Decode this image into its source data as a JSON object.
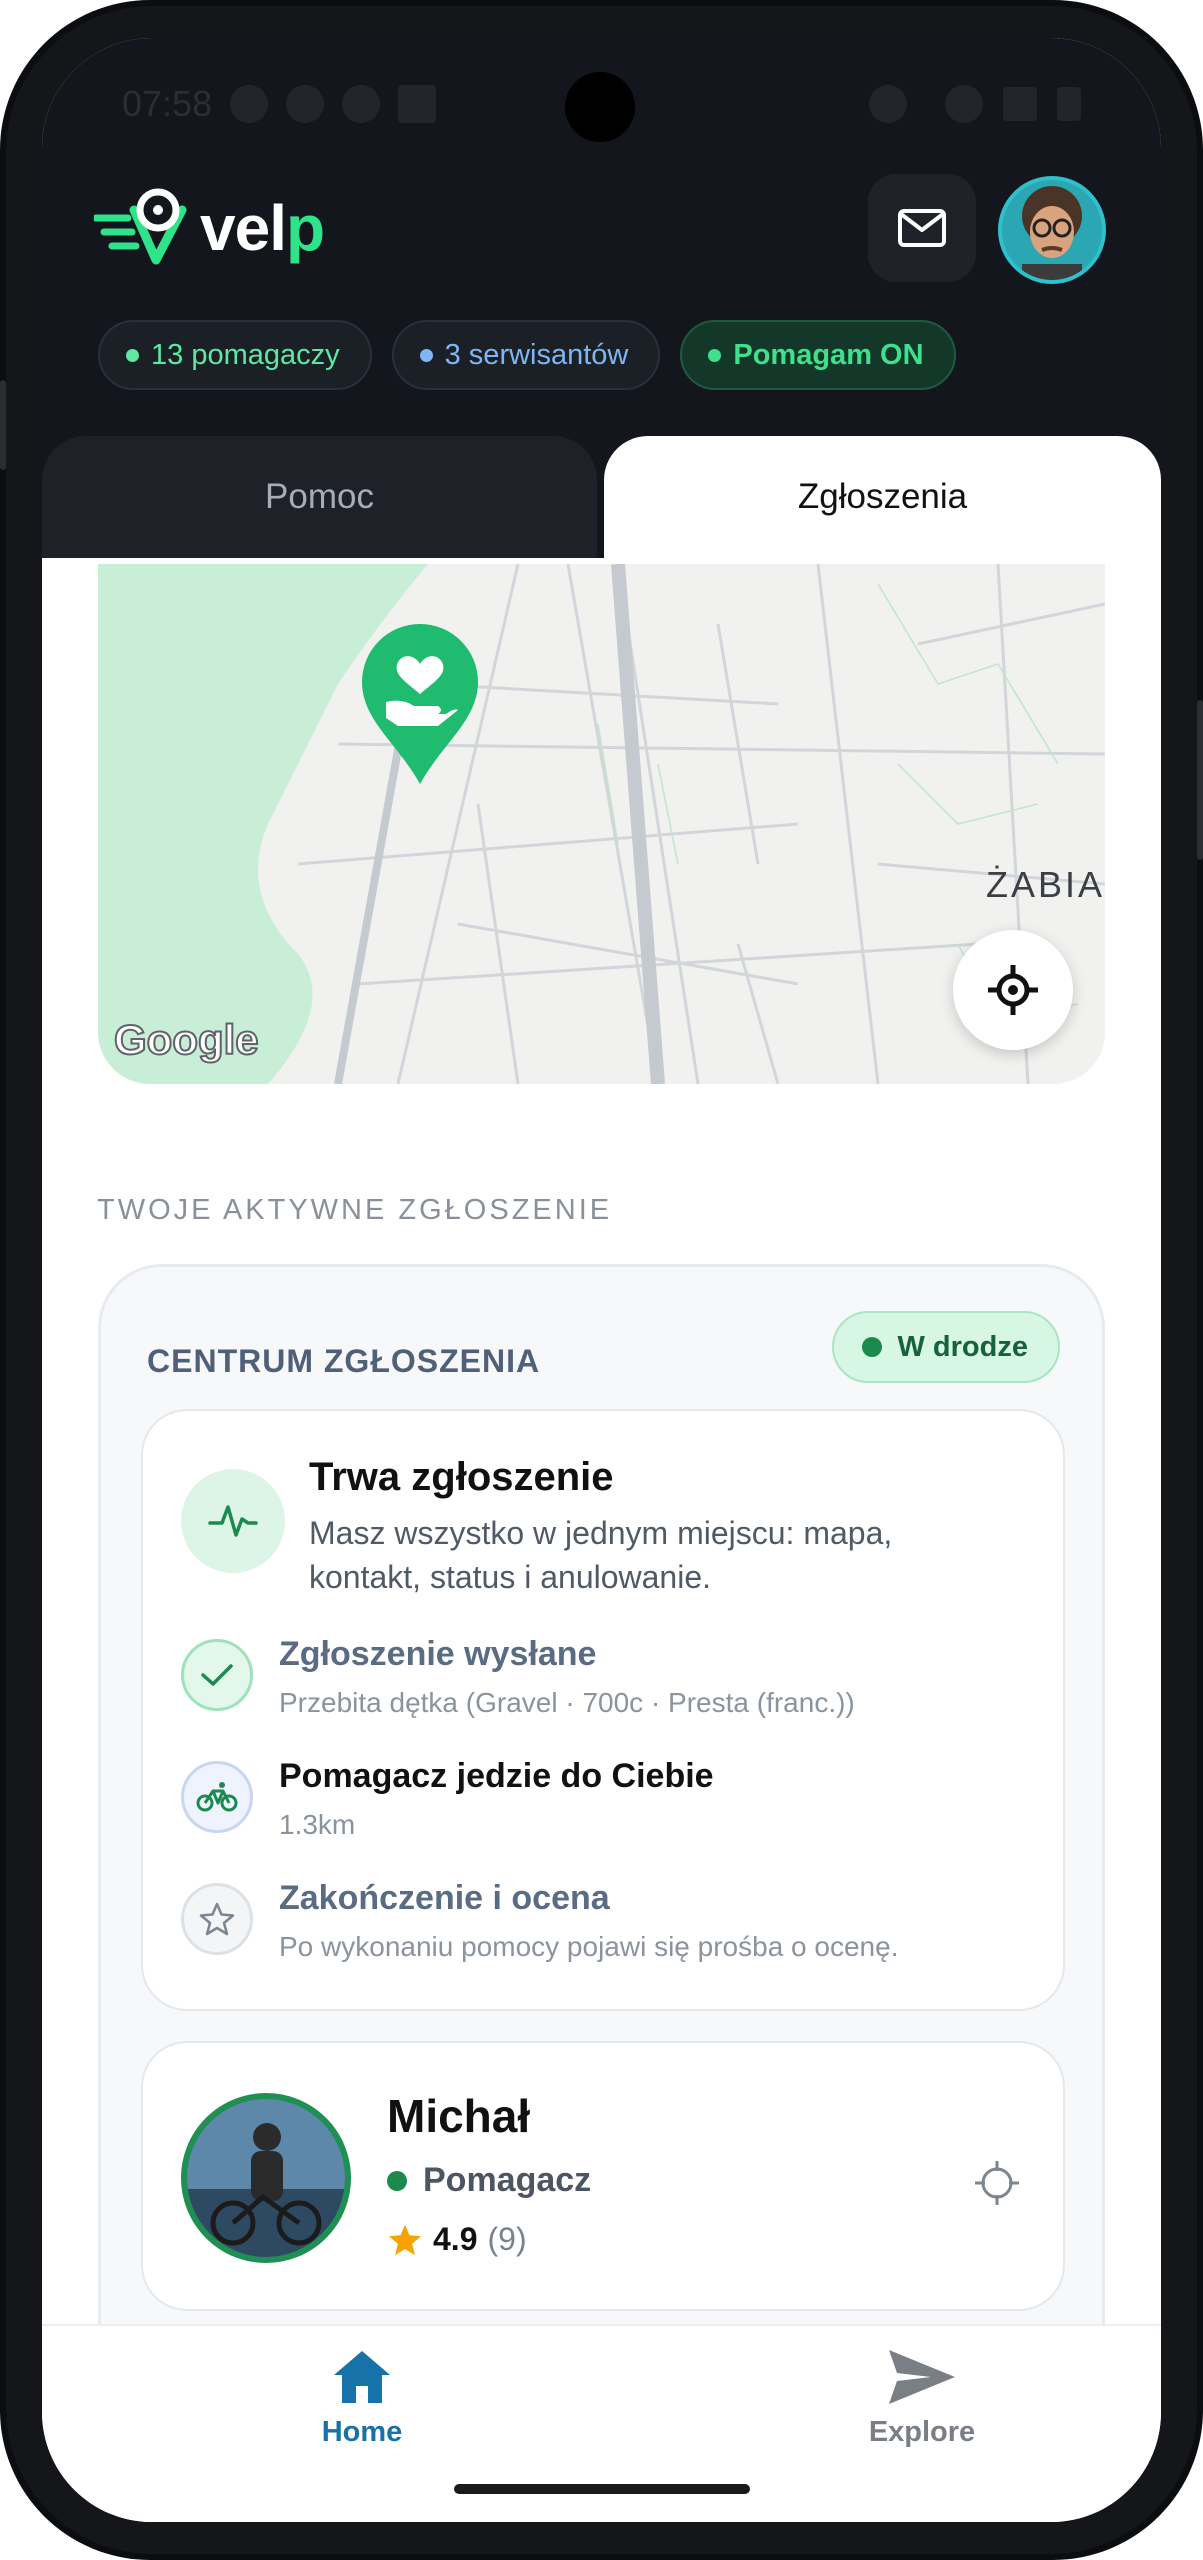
{
  "status_bar": {
    "time": "07:58"
  },
  "header": {
    "logo_text": "vel",
    "logo_text_accent": "p",
    "chips": [
      {
        "label": "13 pomagaczy",
        "color": "#5fe8a2"
      },
      {
        "label": "3 serwisantów",
        "color": "#7fb5f2"
      },
      {
        "label": "Pomagam ON",
        "color": "#3ee08b"
      }
    ]
  },
  "tabs": [
    {
      "label": "Pomoc",
      "active": false
    },
    {
      "label": "Zgłoszenia",
      "active": true
    }
  ],
  "map": {
    "district_label": "ŻABIA",
    "attribution": "Google",
    "marker_icon": "heart-hand-icon"
  },
  "active_section_label": "TWOJE AKTYWNE ZGŁOSZENIE",
  "request_center": {
    "title": "CENTRUM ZGŁOSZENIA",
    "status_badge": "W drodze",
    "summary_title": "Trwa zgłoszenie",
    "summary_text": "Masz wszystko w jednym miejscu: mapa, kontakt, status i anulowanie.",
    "steps": [
      {
        "title": "Zgłoszenie wysłane",
        "subtitle": "Przebita dętka (Gravel · 700c · Presta (franc.))",
        "state": "done"
      },
      {
        "title": "Pomagacz jedzie do Ciebie",
        "subtitle": "1.3km",
        "state": "active"
      },
      {
        "title": "Zakończenie i ocena",
        "subtitle": "Po wykonaniu pomocy pojawi się prośba o ocenę.",
        "state": "pending"
      }
    ]
  },
  "helper": {
    "name": "Michał",
    "role": "Pomagacz",
    "rating": "4.9",
    "rating_count": "(9)"
  },
  "bottom_nav": [
    {
      "label": "Home",
      "icon": "home-icon",
      "active": true
    },
    {
      "label": "Explore",
      "icon": "send-icon",
      "active": false
    }
  ],
  "colors": {
    "accent_green": "#2ee38a",
    "brand_dark": "#13161c",
    "nav_active": "#1672a8"
  }
}
